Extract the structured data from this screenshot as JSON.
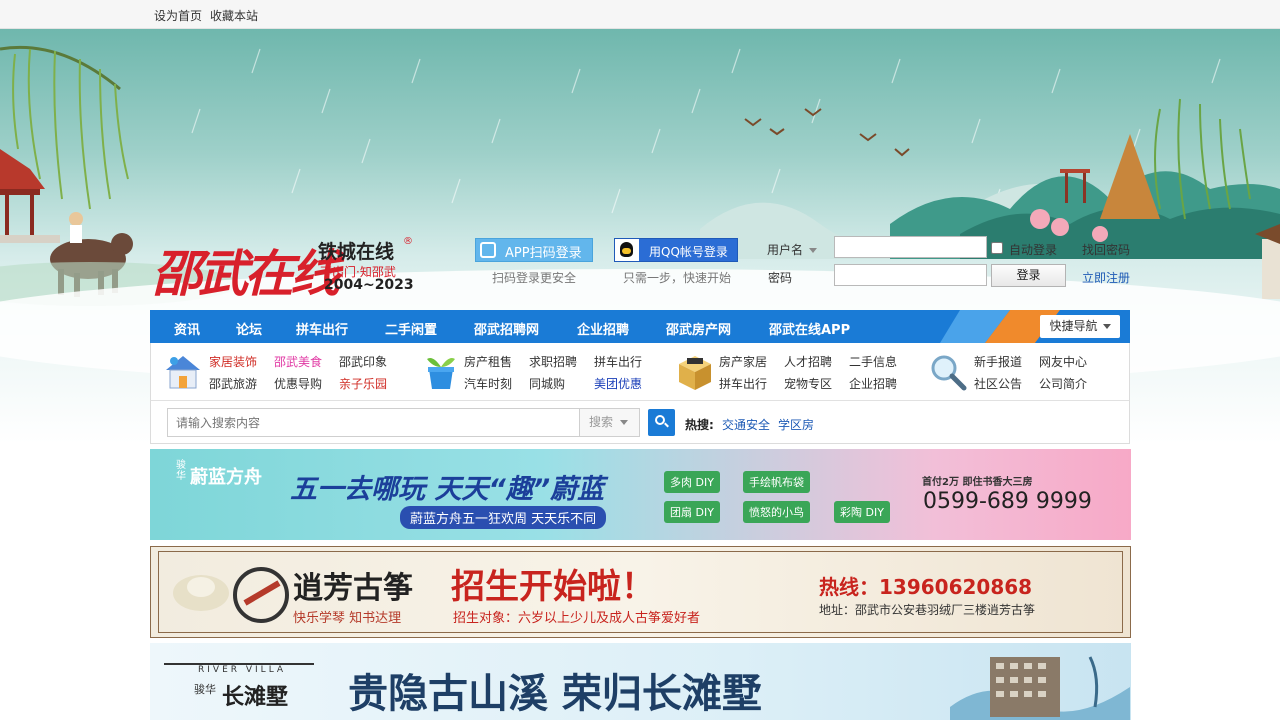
{
  "topbar": {
    "set_home": "设为首页",
    "bookmark": "收藏本站"
  },
  "logo": {
    "name": "邵武在线",
    "subtitle": "铁城在线",
    "registered": "®",
    "slogan": "不出门·知邵武",
    "years": "2004~2023"
  },
  "login": {
    "app_button": "APP扫码登录",
    "app_hint": "扫码登录更安全",
    "qq_button": "用QQ帐号登录",
    "qq_hint": "只需一步，快速开始",
    "username_label": "用户名",
    "password_label": "密码",
    "auto_login": "自动登录",
    "find_password": "找回密码",
    "login_button": "登录",
    "register": "立即注册"
  },
  "nav": {
    "items": [
      "资讯",
      "论坛",
      "拼车出行",
      "二手闲置",
      "邵武招聘网",
      "企业招聘",
      "邵武房产网",
      "邵武在线APP"
    ],
    "quick": "快捷导航"
  },
  "categories": {
    "g1": [
      "家居装饰",
      "邵武美食",
      "邵武印象",
      "邵武旅游",
      "优惠导购",
      "亲子乐园"
    ],
    "g2": [
      "房产租售",
      "求职招聘",
      "拼车出行",
      "汽车时刻",
      "同城购",
      "美团优惠"
    ],
    "g3": [
      "房产家居",
      "人才招聘",
      "二手信息",
      "拼车出行",
      "宠物专区",
      "企业招聘"
    ],
    "g4": [
      "新手报道",
      "网友中心",
      "社区公告",
      "公司简介"
    ]
  },
  "search": {
    "placeholder": "请输入搜索内容",
    "type": "搜索",
    "hot_label": "热搜:",
    "hot": [
      "交通安全",
      "学区房"
    ]
  },
  "banners": {
    "b1": {
      "brand": "蔚蓝方舟",
      "brand_prefix": "骏华",
      "headline": "五一去哪玩 天天“趣”蔚蓝",
      "sub": "蔚蓝方舟五一狂欢周 天天乐不同",
      "tags": [
        "多肉 DIY",
        "手绘帆布袋",
        "团扇 DIY",
        "愤怒的小鸟",
        "彩陶 DIY"
      ],
      "promo": "首付2万 即住书香大三房",
      "phone": "0599-689 9999"
    },
    "b2": {
      "brand": "逍芳古筝",
      "tagline": "快乐学琴  知书达理",
      "headline": "招生开始啦！",
      "target": "招生对象：六岁以上少儿及成人古筝爱好者",
      "hotline": "热线：13960620868",
      "address": "地址：邵武市公安巷羽绒厂三楼逍芳古筝"
    },
    "b3": {
      "brand_en": "RIVER VILLA",
      "brand_prefix": "骏华",
      "brand": "长滩墅",
      "headline": "贵隐古山溪  荣归长滩墅"
    }
  },
  "colors": {
    "nav_blue": "#1a7bd6",
    "logo_red": "#d8202b",
    "link_blue": "#1d5ab5"
  }
}
